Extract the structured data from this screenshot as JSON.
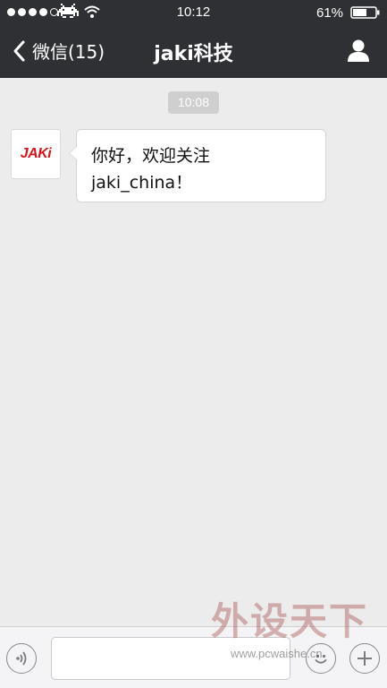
{
  "status_bar": {
    "time": "10:12",
    "battery": "61%",
    "signal_icon": "signal-dots-icon",
    "carrier_icon": "space-invader-icon",
    "wifi_icon": "wifi-icon",
    "battery_icon": "battery-icon"
  },
  "nav": {
    "back_label": "微信(15)",
    "title": "jaki科技",
    "profile_icon": "person-icon"
  },
  "chat": {
    "timestamp": "10:08",
    "messages": [
      {
        "sender_avatar": "JAKi",
        "line1": "你好，欢迎关注",
        "line2": "jaki_china！"
      }
    ]
  },
  "input_bar": {
    "voice_icon": "voice-icon",
    "input_placeholder": "",
    "emoji_icon": "emoji-icon",
    "plus_icon": "plus-icon"
  },
  "watermark": {
    "text": "外设天下",
    "url": "www.pcwaishe.cn"
  },
  "colors": {
    "topbar": "#2e3033",
    "background": "#ececec",
    "brand_red": "#d3161e"
  }
}
